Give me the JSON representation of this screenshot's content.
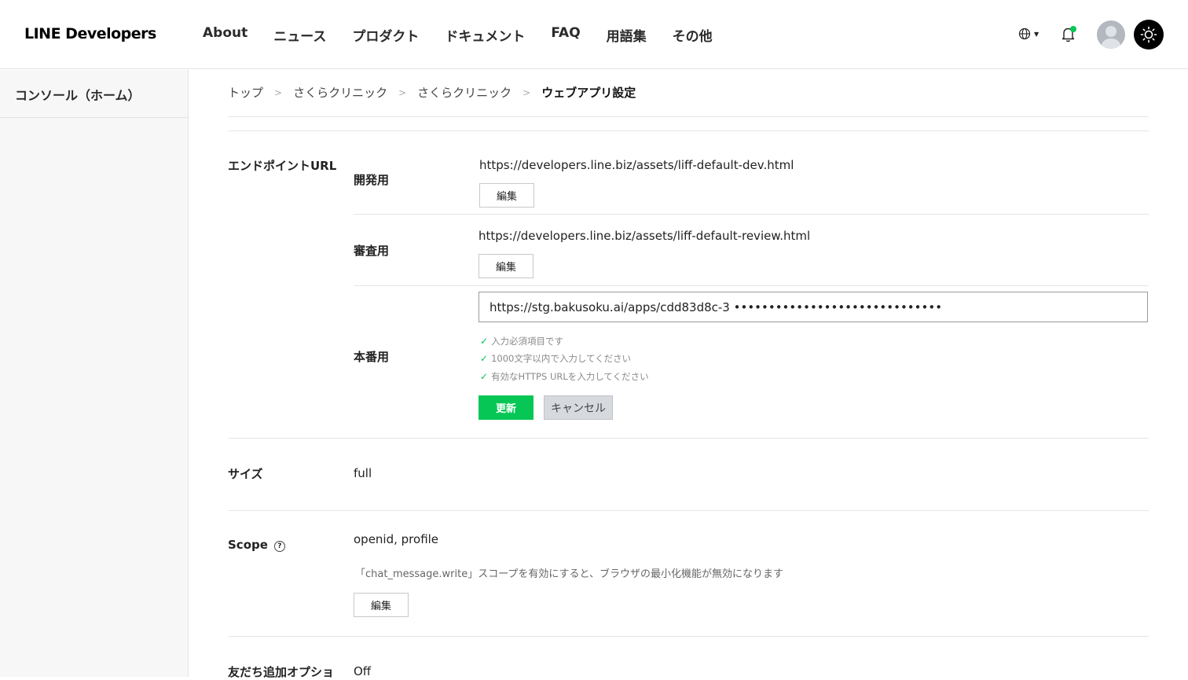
{
  "header": {
    "logo": "LINE Developers",
    "nav": [
      "About",
      "ニュース",
      "プロダクト",
      "ドキュメント",
      "FAQ",
      "用語集",
      "その他"
    ],
    "icons": [
      "globe-icon",
      "bell-icon",
      "avatar",
      "sun-icon"
    ],
    "notification_dot_color": "#06c755"
  },
  "sidebar": {
    "items": [
      {
        "label": "コンソール（ホーム）"
      }
    ]
  },
  "breadcrumb": [
    "トップ",
    "さくらクリニック",
    "さくらクリニック",
    "ウェブアプリ設定"
  ],
  "endpoint": {
    "label": "エンドポイントURL",
    "dev": {
      "label": "開発用",
      "url": "https://developers.line.biz/assets/liff-default-dev.html",
      "edit_label": "編集"
    },
    "review": {
      "label": "審査用",
      "url": "https://developers.line.biz/assets/liff-default-review.html",
      "edit_label": "編集"
    },
    "prod": {
      "label": "本番用",
      "input_value": "https://stg.bakusoku.ai/apps/cdd83d8c-3 ••••••••••••••••••••••••••••••",
      "checks": [
        "入力必須項目です",
        "1000文字以内で入力してください",
        "有効なHTTPS URLを入力してください"
      ],
      "update_label": "更新",
      "cancel_label": "キャンセル"
    }
  },
  "size": {
    "label": "サイズ",
    "value": "full"
  },
  "scope": {
    "label": "Scope",
    "value": "openid, profile",
    "note": "「chat_message.write」スコープを有効にすると、ブラウザの最小化機能が無効になります",
    "edit_label": "編集"
  },
  "friend_option": {
    "label": "友だち追加オプショ",
    "value": "Off"
  },
  "colors": {
    "accent_green": "#06c755",
    "cancel_gray": "#d6d9de"
  }
}
